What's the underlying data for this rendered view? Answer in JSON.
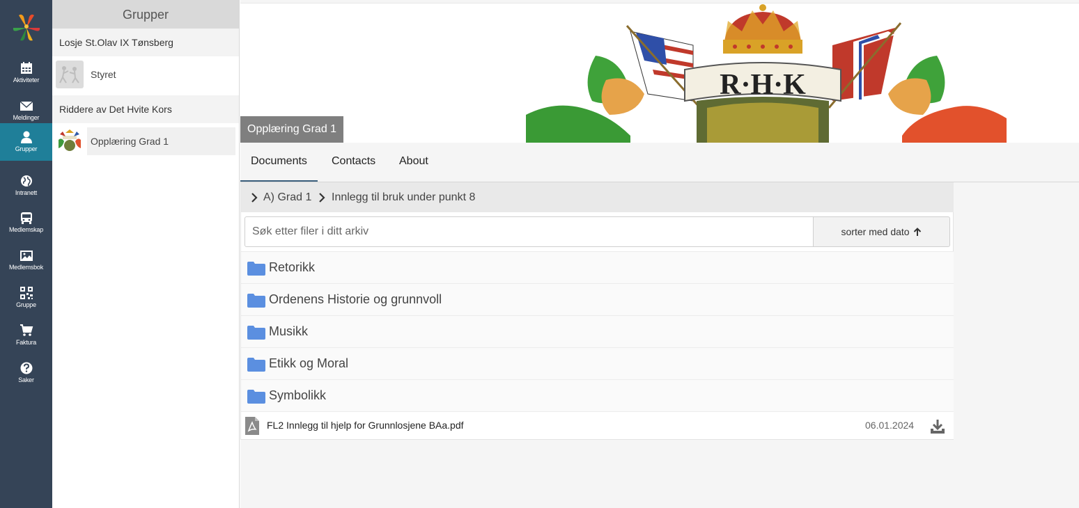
{
  "nav": {
    "items": [
      {
        "label": "Aktiviteter",
        "icon": "calendar-icon"
      },
      {
        "label": "Meldinger",
        "icon": "envelope-icon"
      },
      {
        "label": "Grupper",
        "icon": "user-icon"
      },
      {
        "label": "Intranett",
        "icon": "globe-icon"
      },
      {
        "label": "Medlemskap",
        "icon": "bus-icon"
      },
      {
        "label": "Medlemsbok",
        "icon": "image-icon"
      },
      {
        "label": "Gruppe",
        "icon": "qr-code-icon"
      },
      {
        "label": "Faktura",
        "icon": "cart-icon"
      },
      {
        "label": "Saker",
        "icon": "question-icon"
      }
    ],
    "active": "Grupper"
  },
  "groups": {
    "title": "Grupper",
    "sections": [
      {
        "name": "Losje St.Olav IX Tønsberg",
        "items": [
          {
            "name": "Styret"
          }
        ]
      },
      {
        "name": "Riddere av Det Hvite Kors",
        "items": [
          {
            "name": "Opplæring Grad 1"
          }
        ]
      }
    ]
  },
  "header": {
    "group_title": "Opplæring Grad 1",
    "banner_text": "R·H·K"
  },
  "tabs": [
    {
      "label": "Documents"
    },
    {
      "label": "Contacts"
    },
    {
      "label": "About"
    }
  ],
  "active_tab": "Documents",
  "breadcrumb": [
    "A) Grad 1",
    "Innlegg til bruk under punkt 8"
  ],
  "search": {
    "placeholder": "Søk etter filer i ditt arkiv",
    "value": ""
  },
  "sort": {
    "label": "sorter med dato"
  },
  "folders": [
    {
      "name": "Retorikk"
    },
    {
      "name": "Ordenens Historie og grunnvoll"
    },
    {
      "name": "Musikk"
    },
    {
      "name": "Etikk og Moral"
    },
    {
      "name": "Symbolikk"
    }
  ],
  "files": [
    {
      "name": "FL2 Innlegg til hjelp for Grunnlosjene BAa.pdf",
      "date": "06.01.2024"
    }
  ],
  "colors": {
    "rail": "#354457",
    "rail_active": "#1f7f99",
    "folder": "#5b8fe0",
    "tab_underline": "#3b5f7c"
  }
}
